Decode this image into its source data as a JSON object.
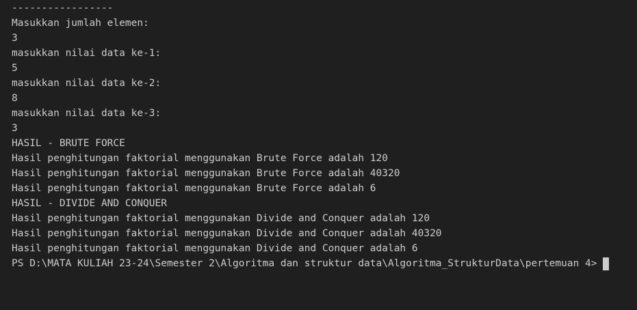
{
  "terminal": {
    "separator": "-----------------",
    "lines": [
      "Masukkan jumlah elemen:",
      "3",
      "masukkan nilai data ke-1:",
      "5",
      "masukkan nilai data ke-2:",
      "8",
      "masukkan nilai data ke-3:",
      "3",
      "HASIL - BRUTE FORCE",
      "Hasil penghitungan faktorial menggunakan Brute Force adalah 120",
      "Hasil penghitungan faktorial menggunakan Brute Force adalah 40320",
      "Hasil penghitungan faktorial menggunakan Brute Force adalah 6",
      "HASIL - DIVIDE AND CONQUER",
      "Hasil penghitungan faktorial menggunakan Divide and Conquer adalah 120",
      "Hasil penghitungan faktorial menggunakan Divide and Conquer adalah 40320",
      "Hasil penghitungan faktorial menggunakan Divide and Conquer adalah 6"
    ],
    "prompt": "PS D:\\MATA KULIAH 23-24\\Semester 2\\Algoritma dan struktur data\\Algoritma_StrukturData\\pertemuan 4>"
  }
}
